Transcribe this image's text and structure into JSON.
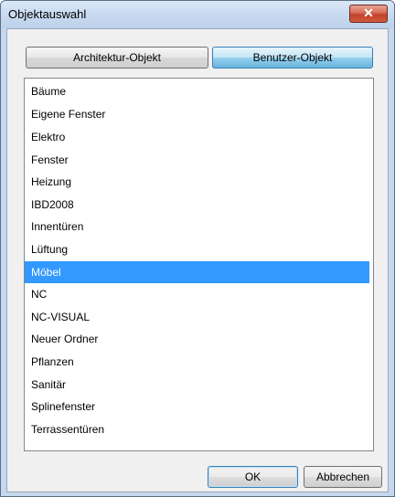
{
  "window": {
    "title": "Objektauswahl",
    "close_glyph": "✕"
  },
  "tabs": {
    "architecture_label": "Architektur-Objekt",
    "user_label": "Benutzer-Objekt",
    "active": "Benutzer-Objekt"
  },
  "list": {
    "items": [
      {
        "label": "Bäume"
      },
      {
        "label": "Eigene Fenster"
      },
      {
        "label": "Elektro"
      },
      {
        "label": "Fenster"
      },
      {
        "label": "Heizung"
      },
      {
        "label": "IBD2008"
      },
      {
        "label": "Innentüren"
      },
      {
        "label": "Lüftung"
      },
      {
        "label": "Möbel"
      },
      {
        "label": "NC"
      },
      {
        "label": "NC-VISUAL"
      },
      {
        "label": "Neuer Ordner"
      },
      {
        "label": "Pflanzen"
      },
      {
        "label": "Sanitär"
      },
      {
        "label": "Splinefenster"
      },
      {
        "label": "Terrassentüren"
      }
    ],
    "selected": "Möbel"
  },
  "scrollbar": {
    "up_glyph": "▲",
    "down_glyph": "▼"
  },
  "buttons": {
    "ok_label": "OK",
    "cancel_label": "Abbrechen"
  },
  "colors": {
    "selection": "#3399ff",
    "title_bar": "#c8daf0",
    "close_button": "#c1432c"
  }
}
